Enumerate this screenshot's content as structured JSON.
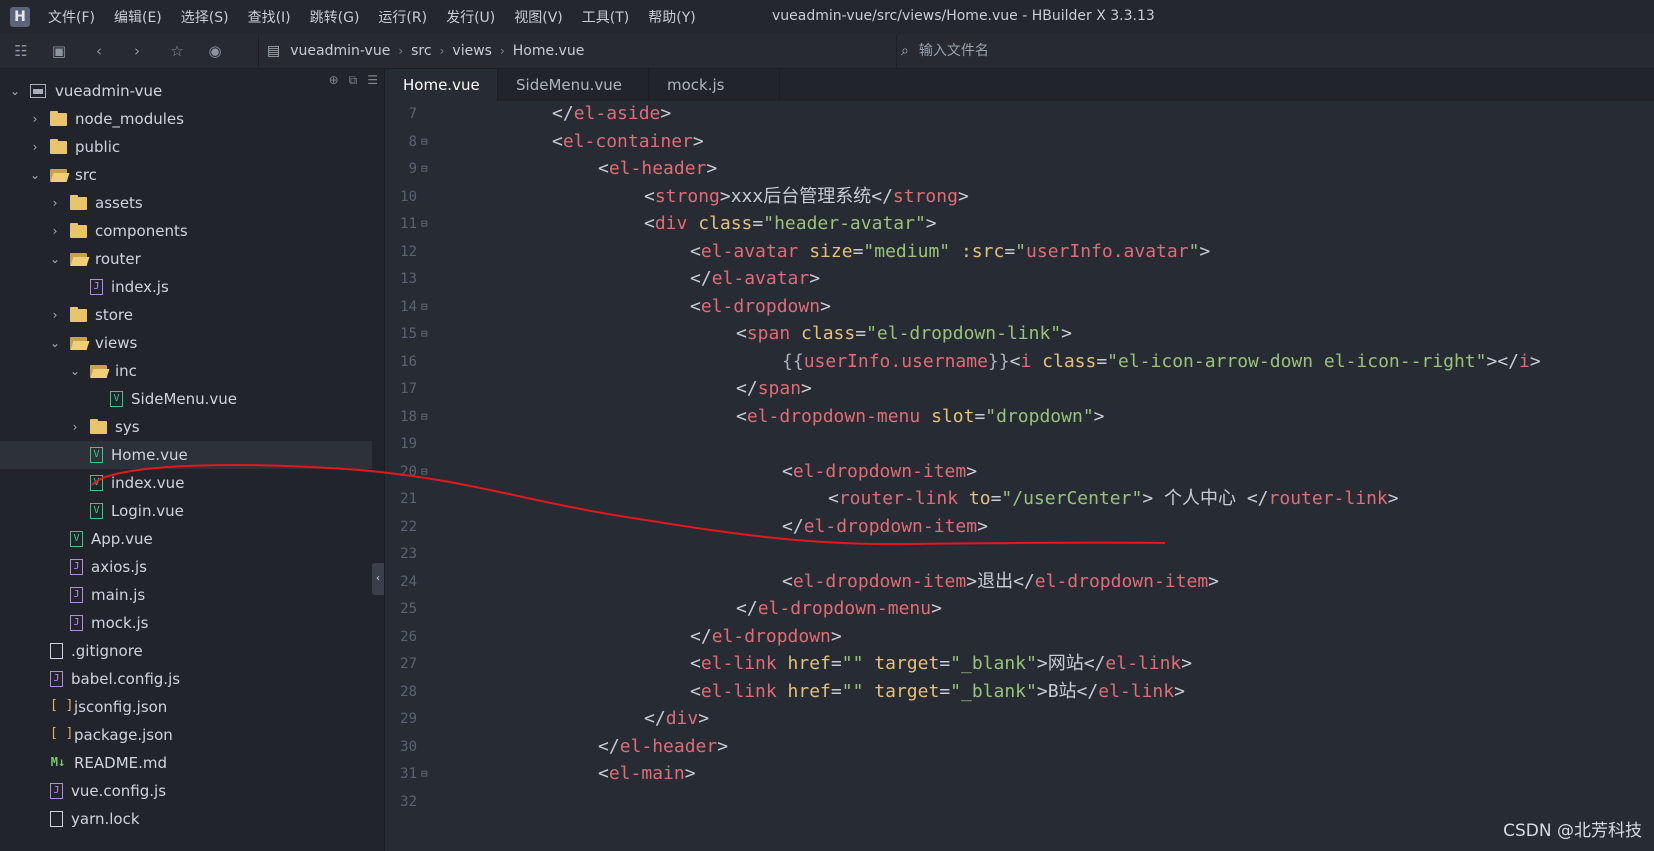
{
  "menubar": {
    "items": [
      "文件(F)",
      "编辑(E)",
      "选择(S)",
      "查找(I)",
      "跳转(G)",
      "运行(R)",
      "发行(U)",
      "视图(V)",
      "工具(T)",
      "帮助(Y)"
    ],
    "window_title": "vueadmin-vue/src/views/Home.vue - HBuilder X 3.3.13",
    "logo": "H"
  },
  "toolbar": {
    "breadcrumb": [
      "vueadmin-vue",
      "src",
      "views",
      "Home.vue"
    ],
    "file_search_placeholder": "输入文件名"
  },
  "sidebar": {
    "rows": [
      {
        "label": "vueadmin-vue",
        "kind": "project",
        "depth": 0,
        "chevron": "down"
      },
      {
        "label": "node_modules",
        "kind": "folder",
        "depth": 1,
        "chevron": "right"
      },
      {
        "label": "public",
        "kind": "folder",
        "depth": 1,
        "chevron": "right"
      },
      {
        "label": "src",
        "kind": "folder-open",
        "depth": 1,
        "chevron": "down"
      },
      {
        "label": "assets",
        "kind": "folder",
        "depth": 2,
        "chevron": "right"
      },
      {
        "label": "components",
        "kind": "folder",
        "depth": 2,
        "chevron": "right"
      },
      {
        "label": "router",
        "kind": "folder-open",
        "depth": 2,
        "chevron": "down"
      },
      {
        "label": "index.js",
        "kind": "js",
        "depth": 3,
        "chevron": ""
      },
      {
        "label": "store",
        "kind": "folder",
        "depth": 2,
        "chevron": "right"
      },
      {
        "label": "views",
        "kind": "folder-open",
        "depth": 2,
        "chevron": "down"
      },
      {
        "label": "inc",
        "kind": "folder-open",
        "depth": 3,
        "chevron": "down"
      },
      {
        "label": "SideMenu.vue",
        "kind": "vue",
        "depth": 4,
        "chevron": ""
      },
      {
        "label": "sys",
        "kind": "folder",
        "depth": 3,
        "chevron": "right"
      },
      {
        "label": "Home.vue",
        "kind": "vue",
        "depth": 3,
        "chevron": "",
        "selected": true
      },
      {
        "label": "index.vue",
        "kind": "vue",
        "depth": 3,
        "chevron": ""
      },
      {
        "label": "Login.vue",
        "kind": "vue",
        "depth": 3,
        "chevron": ""
      },
      {
        "label": "App.vue",
        "kind": "vue",
        "depth": 2,
        "chevron": ""
      },
      {
        "label": "axios.js",
        "kind": "js",
        "depth": 2,
        "chevron": ""
      },
      {
        "label": "main.js",
        "kind": "js",
        "depth": 2,
        "chevron": ""
      },
      {
        "label": "mock.js",
        "kind": "js",
        "depth": 2,
        "chevron": ""
      },
      {
        "label": ".gitignore",
        "kind": "plain",
        "depth": 1,
        "chevron": ""
      },
      {
        "label": "babel.config.js",
        "kind": "js",
        "depth": 1,
        "chevron": ""
      },
      {
        "label": "jsconfig.json",
        "kind": "json",
        "depth": 1,
        "chevron": ""
      },
      {
        "label": "package.json",
        "kind": "json",
        "depth": 1,
        "chevron": ""
      },
      {
        "label": "README.md",
        "kind": "md",
        "depth": 1,
        "chevron": ""
      },
      {
        "label": "vue.config.js",
        "kind": "js",
        "depth": 1,
        "chevron": ""
      },
      {
        "label": "yarn.lock",
        "kind": "plain",
        "depth": 1,
        "chevron": ""
      }
    ]
  },
  "tabs": [
    {
      "label": "Home.vue",
      "active": true
    },
    {
      "label": "SideMenu.vue",
      "active": false
    },
    {
      "label": "mock.js",
      "active": false
    }
  ],
  "editor": {
    "lines": [
      {
        "n": "7",
        "fold": false,
        "indent": 2,
        "tokens": [
          [
            "p",
            "</"
          ],
          [
            "t",
            "el-aside"
          ],
          [
            "p",
            ">"
          ]
        ]
      },
      {
        "n": "8",
        "fold": true,
        "indent": 2,
        "tokens": [
          [
            "p",
            "<"
          ],
          [
            "t",
            "el-container"
          ],
          [
            "p",
            ">"
          ]
        ]
      },
      {
        "n": "9",
        "fold": true,
        "indent": 3,
        "tokens": [
          [
            "p",
            "<"
          ],
          [
            "t",
            "el-header"
          ],
          [
            "p",
            ">"
          ]
        ]
      },
      {
        "n": "10",
        "fold": false,
        "indent": 4,
        "tokens": [
          [
            "p",
            "<"
          ],
          [
            "t",
            "strong"
          ],
          [
            "p",
            ">"
          ],
          [
            "x",
            "xxx后台管理系统"
          ],
          [
            "p",
            "</"
          ],
          [
            "t",
            "strong"
          ],
          [
            "p",
            ">"
          ]
        ]
      },
      {
        "n": "11",
        "fold": true,
        "indent": 4,
        "tokens": [
          [
            "p",
            "<"
          ],
          [
            "t",
            "div "
          ],
          [
            "a",
            "class"
          ],
          [
            "p",
            "="
          ],
          [
            "s",
            "\"header-avatar\""
          ],
          [
            "p",
            ">"
          ]
        ]
      },
      {
        "n": "12",
        "fold": false,
        "indent": 5,
        "tokens": [
          [
            "p",
            "<"
          ],
          [
            "t",
            "el-avatar "
          ],
          [
            "a",
            "size"
          ],
          [
            "p",
            "="
          ],
          [
            "s",
            "\"medium\""
          ],
          [
            "p",
            " "
          ],
          [
            "a",
            ":src"
          ],
          [
            "p",
            "="
          ],
          [
            "s",
            "\""
          ],
          [
            "t",
            "userInfo.avatar"
          ],
          [
            "s",
            "\""
          ],
          [
            "p",
            ">"
          ]
        ]
      },
      {
        "n": "13",
        "fold": false,
        "indent": 5,
        "tokens": [
          [
            "p",
            "</"
          ],
          [
            "t",
            "el-avatar"
          ],
          [
            "p",
            ">"
          ]
        ]
      },
      {
        "n": "14",
        "fold": true,
        "indent": 5,
        "tokens": [
          [
            "p",
            "<"
          ],
          [
            "t",
            "el-dropdown"
          ],
          [
            "p",
            ">"
          ]
        ]
      },
      {
        "n": "15",
        "fold": true,
        "indent": 6,
        "tokens": [
          [
            "p",
            "<"
          ],
          [
            "t",
            "span "
          ],
          [
            "a",
            "class"
          ],
          [
            "p",
            "="
          ],
          [
            "s",
            "\"el-dropdown-link\""
          ],
          [
            "p",
            ">"
          ]
        ]
      },
      {
        "n": "16",
        "fold": false,
        "indent": 7,
        "tokens": [
          [
            "b",
            "{{"
          ],
          [
            "t",
            "userInfo.username"
          ],
          [
            "b",
            "}}"
          ],
          [
            "p",
            "<"
          ],
          [
            "t",
            "i "
          ],
          [
            "a",
            "class"
          ],
          [
            "p",
            "="
          ],
          [
            "s",
            "\"el-icon-arrow-down el-icon--right\""
          ],
          [
            "p",
            ">"
          ],
          [
            "p",
            "</"
          ],
          [
            "t",
            "i"
          ],
          [
            "p",
            ">"
          ]
        ]
      },
      {
        "n": "17",
        "fold": false,
        "indent": 6,
        "tokens": [
          [
            "p",
            "</"
          ],
          [
            "t",
            "span"
          ],
          [
            "p",
            ">"
          ]
        ]
      },
      {
        "n": "18",
        "fold": true,
        "indent": 6,
        "tokens": [
          [
            "p",
            "<"
          ],
          [
            "t",
            "el-dropdown-menu "
          ],
          [
            "a",
            "slot"
          ],
          [
            "p",
            "="
          ],
          [
            "s",
            "\"dropdown\""
          ],
          [
            "p",
            ">"
          ]
        ]
      },
      {
        "n": "19",
        "fold": false,
        "indent": 0,
        "tokens": []
      },
      {
        "n": "20",
        "fold": true,
        "indent": 7,
        "tokens": [
          [
            "p",
            "<"
          ],
          [
            "t",
            "el-dropdown-item"
          ],
          [
            "p",
            ">"
          ]
        ]
      },
      {
        "n": "21",
        "fold": false,
        "indent": 8,
        "tokens": [
          [
            "p",
            "<"
          ],
          [
            "t",
            "router-link "
          ],
          [
            "a",
            "to"
          ],
          [
            "p",
            "="
          ],
          [
            "s",
            "\"/userCenter\""
          ],
          [
            "p",
            ">"
          ],
          [
            "x",
            " 个人中心 "
          ],
          [
            "p",
            "</"
          ],
          [
            "t",
            "router-link"
          ],
          [
            "p",
            ">"
          ]
        ]
      },
      {
        "n": "22",
        "fold": false,
        "indent": 7,
        "tokens": [
          [
            "p",
            "</"
          ],
          [
            "t",
            "el-dropdown-item"
          ],
          [
            "p",
            ">"
          ]
        ]
      },
      {
        "n": "23",
        "fold": false,
        "indent": 0,
        "tokens": []
      },
      {
        "n": "24",
        "fold": false,
        "indent": 7,
        "tokens": [
          [
            "p",
            "<"
          ],
          [
            "t",
            "el-dropdown-item"
          ],
          [
            "p",
            ">"
          ],
          [
            "x",
            "退出"
          ],
          [
            "p",
            "</"
          ],
          [
            "t",
            "el-dropdown-item"
          ],
          [
            "p",
            ">"
          ]
        ]
      },
      {
        "n": "25",
        "fold": false,
        "indent": 6,
        "tokens": [
          [
            "p",
            "</"
          ],
          [
            "t",
            "el-dropdown-menu"
          ],
          [
            "p",
            ">"
          ]
        ]
      },
      {
        "n": "26",
        "fold": false,
        "indent": 5,
        "tokens": [
          [
            "p",
            "</"
          ],
          [
            "t",
            "el-dropdown"
          ],
          [
            "p",
            ">"
          ]
        ]
      },
      {
        "n": "27",
        "fold": false,
        "indent": 5,
        "tokens": [
          [
            "p",
            "<"
          ],
          [
            "t",
            "el-link "
          ],
          [
            "a",
            "href"
          ],
          [
            "p",
            "="
          ],
          [
            "s",
            "\"\""
          ],
          [
            "p",
            " "
          ],
          [
            "a",
            "target"
          ],
          [
            "p",
            "="
          ],
          [
            "s",
            "\"_blank\""
          ],
          [
            "p",
            ">"
          ],
          [
            "x",
            "网站"
          ],
          [
            "p",
            "</"
          ],
          [
            "t",
            "el-link"
          ],
          [
            "p",
            ">"
          ]
        ]
      },
      {
        "n": "28",
        "fold": false,
        "indent": 5,
        "tokens": [
          [
            "p",
            "<"
          ],
          [
            "t",
            "el-link "
          ],
          [
            "a",
            "href"
          ],
          [
            "p",
            "="
          ],
          [
            "s",
            "\"\""
          ],
          [
            "p",
            " "
          ],
          [
            "a",
            "target"
          ],
          [
            "p",
            "="
          ],
          [
            "s",
            "\"_blank\""
          ],
          [
            "p",
            ">"
          ],
          [
            "x",
            "B站"
          ],
          [
            "p",
            "</"
          ],
          [
            "t",
            "el-link"
          ],
          [
            "p",
            ">"
          ]
        ]
      },
      {
        "n": "29",
        "fold": false,
        "indent": 4,
        "tokens": [
          [
            "p",
            "</"
          ],
          [
            "t",
            "div"
          ],
          [
            "p",
            ">"
          ]
        ]
      },
      {
        "n": "30",
        "fold": false,
        "indent": 3,
        "tokens": [
          [
            "p",
            "</"
          ],
          [
            "t",
            "el-header"
          ],
          [
            "p",
            ">"
          ]
        ]
      },
      {
        "n": "31",
        "fold": true,
        "indent": 3,
        "tokens": [
          [
            "p",
            "<"
          ],
          [
            "t",
            "el-main"
          ],
          [
            "p",
            ">"
          ]
        ]
      },
      {
        "n": "32",
        "fold": false,
        "indent": 0,
        "tokens": []
      }
    ]
  },
  "watermark": "CSDN @北芳科技",
  "colors": {
    "annotation_red": "#e0191e",
    "editor_bg": "#272b33",
    "sidebar_bg": "#21252b"
  }
}
